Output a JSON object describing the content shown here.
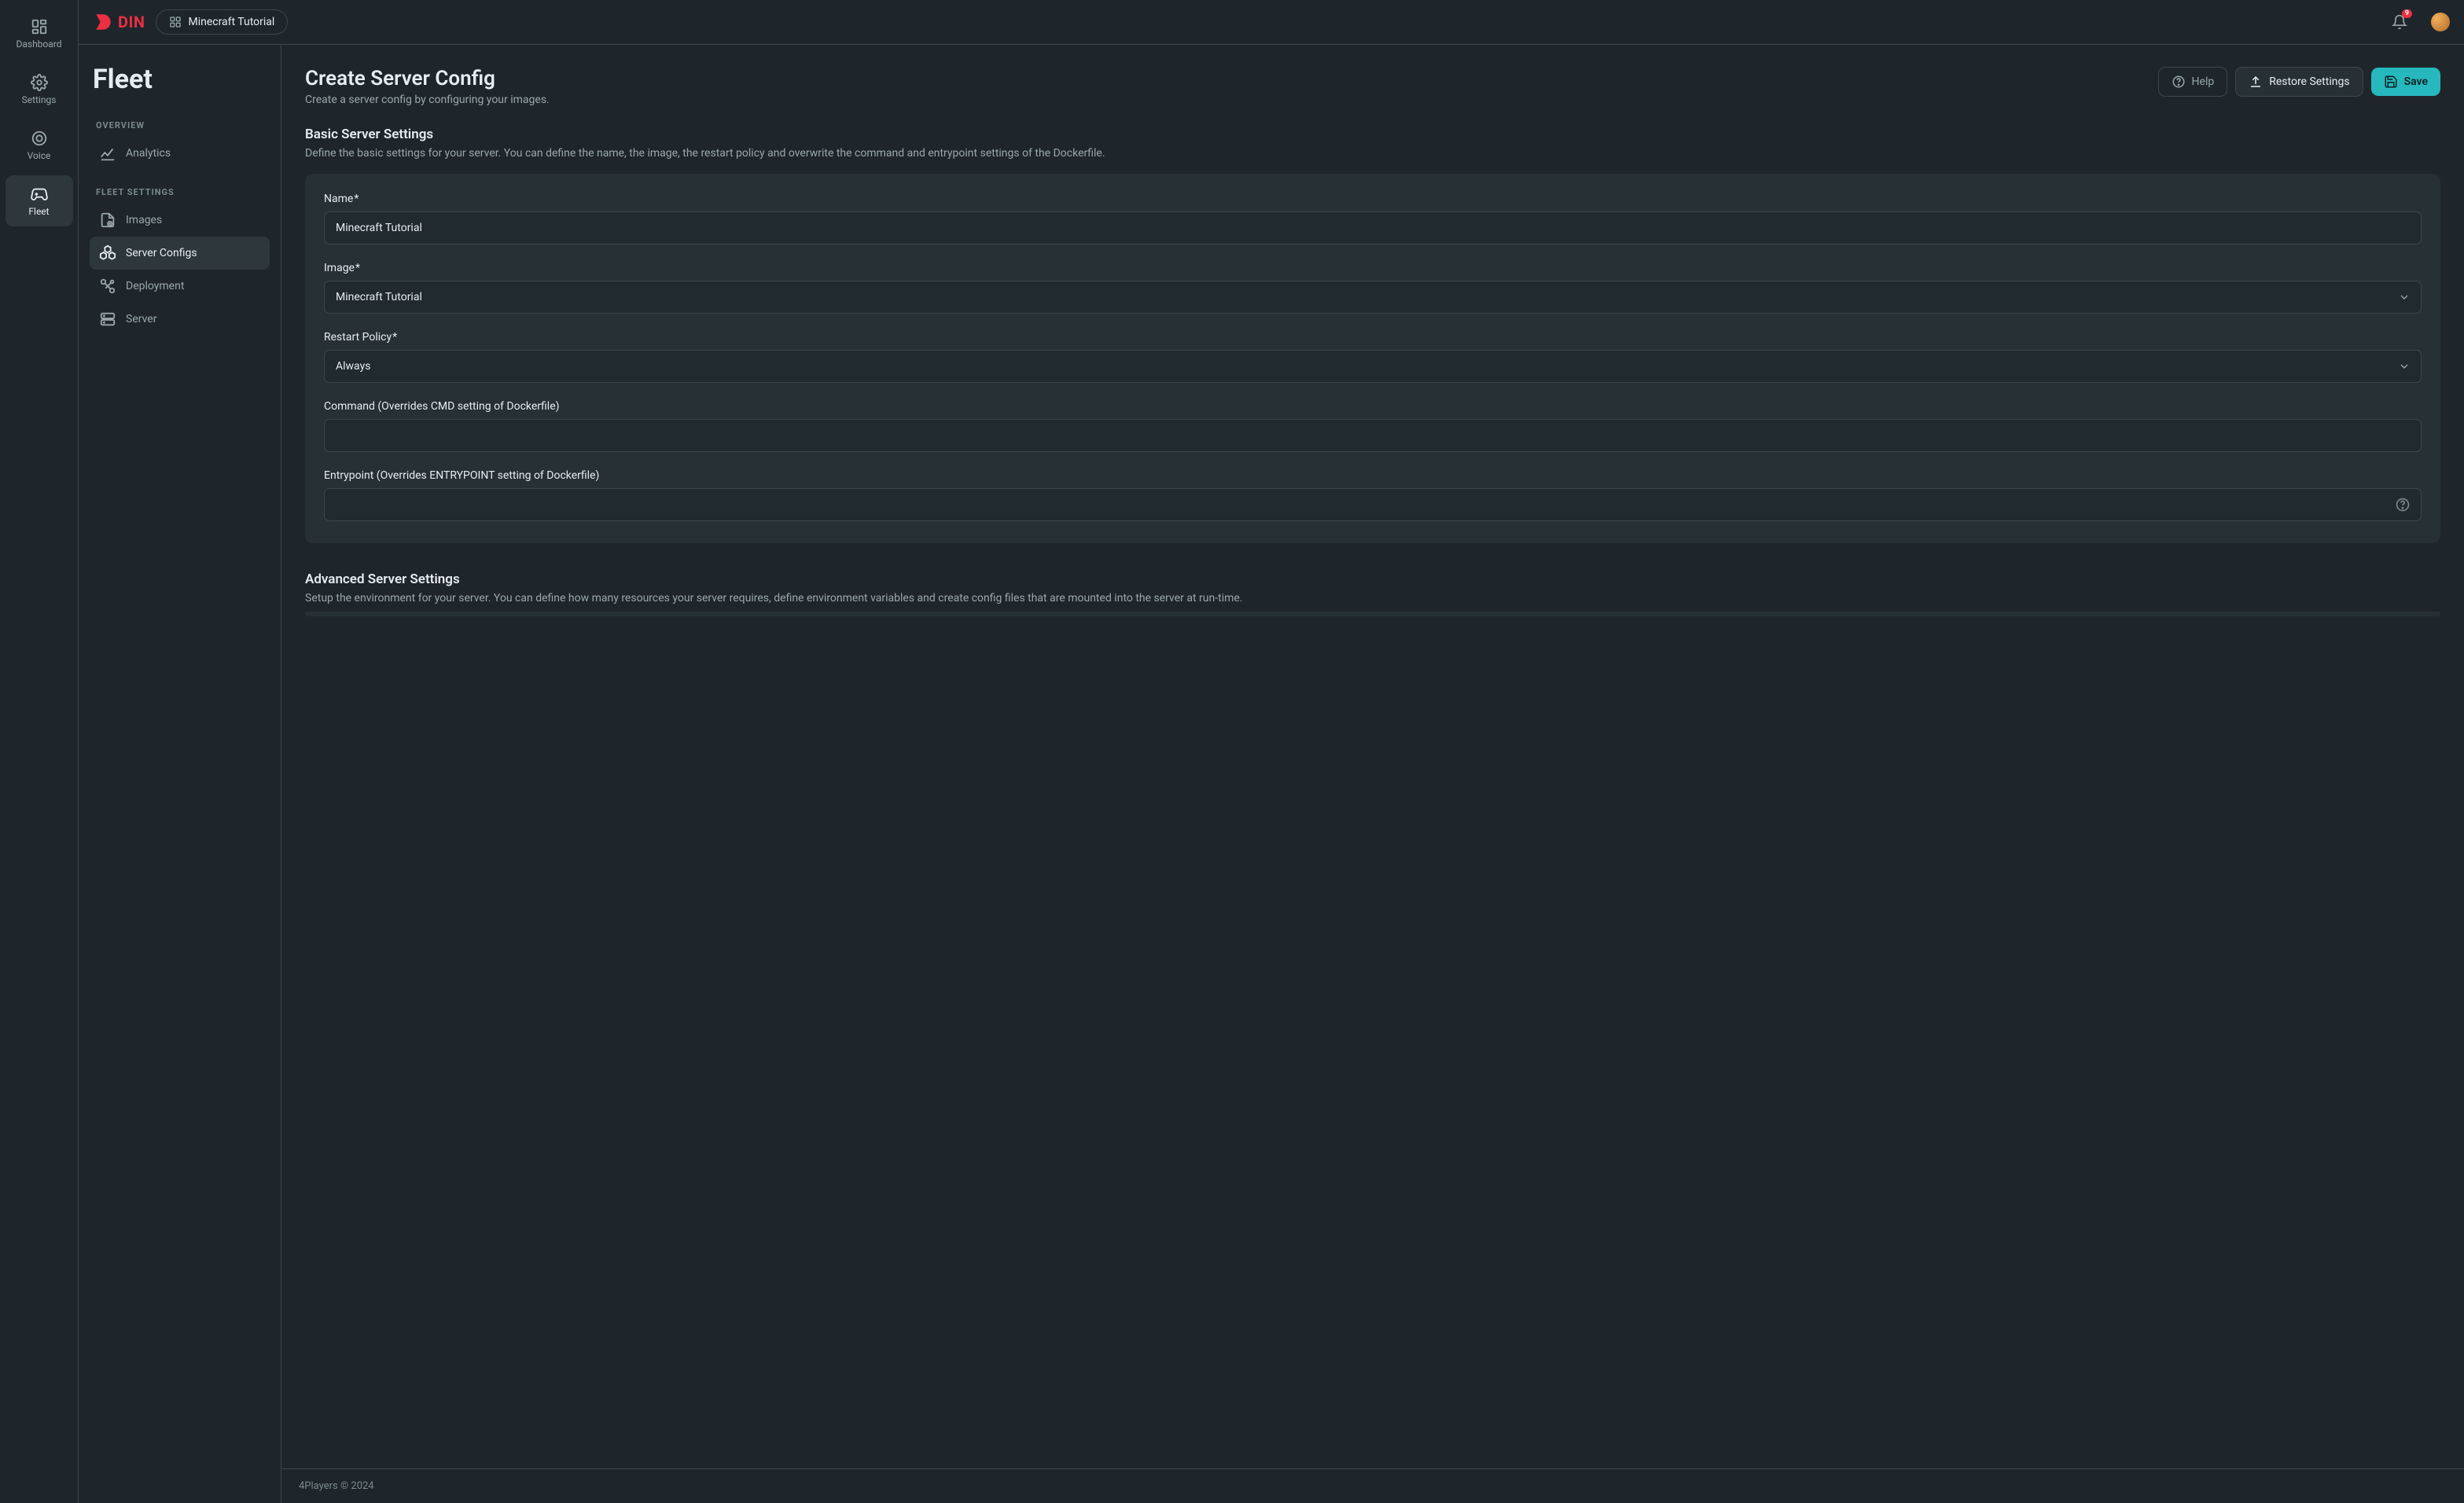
{
  "brand": {
    "name": "DIN"
  },
  "breadcrumb": {
    "label": "Minecraft Tutorial"
  },
  "notifications": {
    "count": "9"
  },
  "sidebar": {
    "items": [
      {
        "label": "Dashboard"
      },
      {
        "label": "Settings"
      },
      {
        "label": "Voice"
      },
      {
        "label": "Fleet"
      }
    ]
  },
  "inner_nav": {
    "title": "Fleet",
    "section_overview": "OVERVIEW",
    "section_fleet": "FLEET SETTINGS",
    "overview_items": [
      {
        "label": "Analytics"
      }
    ],
    "fleet_items": [
      {
        "label": "Images"
      },
      {
        "label": "Server Configs"
      },
      {
        "label": "Deployment"
      },
      {
        "label": "Server"
      }
    ]
  },
  "page": {
    "title": "Create Server Config",
    "subtitle": "Create a server config by configuring your images.",
    "help_label": "Help",
    "restore_label": "Restore Settings",
    "save_label": "Save"
  },
  "basic": {
    "title": "Basic Server Settings",
    "desc": "Define the basic settings for your server. You can define the name, the image, the restart policy and overwrite the command and entrypoint settings of the Dockerfile.",
    "name_label": "Name",
    "name_value": "Minecraft Tutorial",
    "image_label": "Image",
    "image_value": "Minecraft Tutorial",
    "restart_label": "Restart Policy",
    "restart_value": "Always",
    "command_label": "Command (Overrides CMD setting of Dockerfile)",
    "command_value": "",
    "entrypoint_label": "Entrypoint (Overrides ENTRYPOINT setting of Dockerfile)",
    "entrypoint_value": ""
  },
  "advanced": {
    "title": "Advanced Server Settings",
    "desc": "Setup the environment for your server. You can define how many resources your server requires, define environment variables and create config files that are mounted into the server at run-time."
  },
  "footer": {
    "copyright": "4Players © 2024"
  },
  "required_marker": "*"
}
